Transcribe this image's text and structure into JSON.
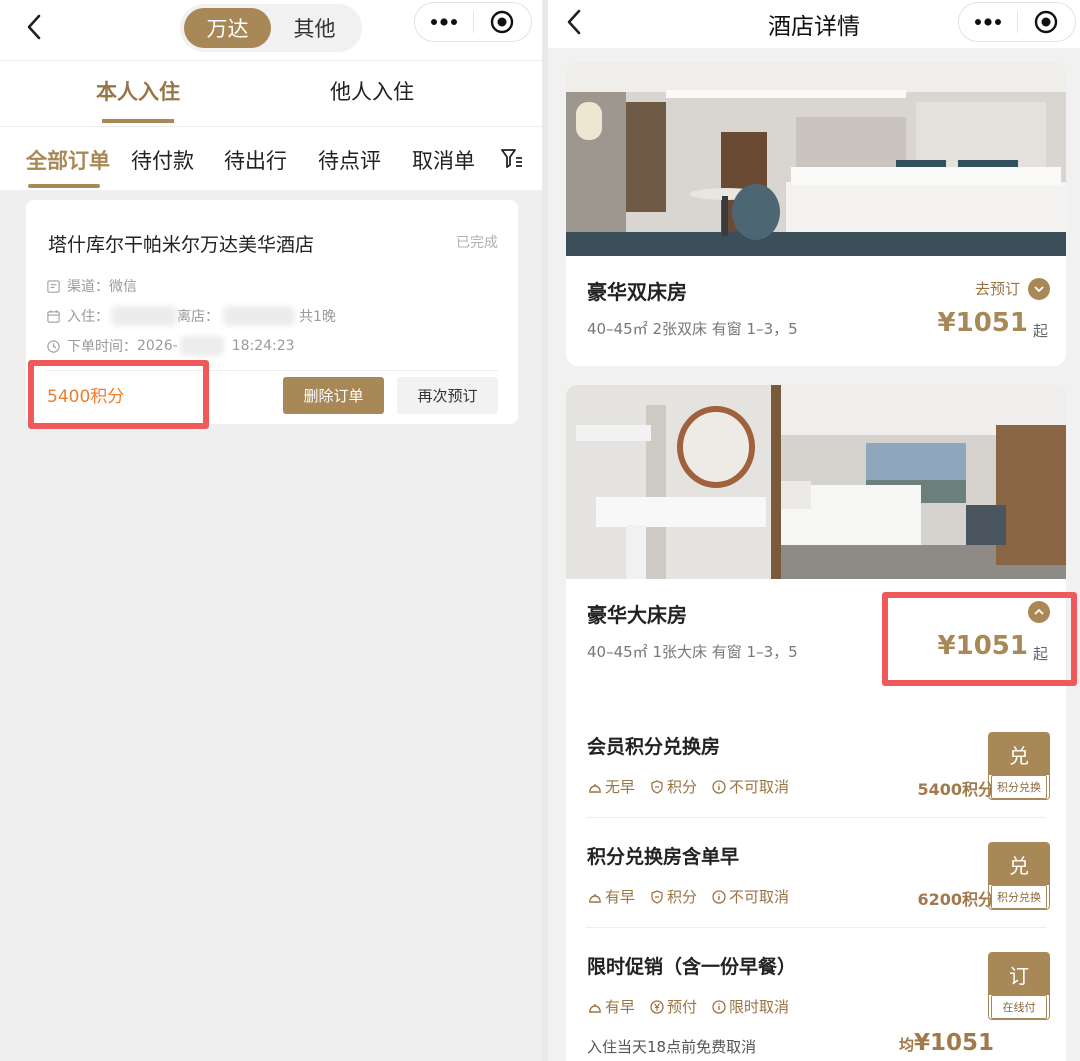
{
  "left": {
    "segment": [
      "万达",
      "其他"
    ],
    "stay_tabs": [
      "本人入住",
      "他人入住"
    ],
    "status_tabs": [
      "全部订单",
      "待付款",
      "待出行",
      "待点评",
      "取消单"
    ],
    "order": {
      "hotel": "塔什库尔干帕米尔万达美华酒店",
      "status": "已完成",
      "channel": "渠道：微信",
      "checkin_label": "入住：",
      "checkout_label": "离店：",
      "nights": "共1晚",
      "order_time_label": "下单时间：",
      "order_time_date": "2026-",
      "order_time_clock": "18:24:23",
      "points": "5400积分",
      "delete_btn": "删除订单",
      "rebook_btn": "再次预订"
    }
  },
  "right": {
    "title": "酒店详情",
    "rooms": [
      {
        "name": "豪华双床房",
        "spec": "40–45㎡ 2张双床 有窗 1–3，5",
        "price": "¥1051",
        "qi": "起",
        "book": "去预订"
      },
      {
        "name": "豪华大床房",
        "spec": "40–45㎡ 1张大床 有窗 1–3，5",
        "price": "¥1051",
        "qi": "起"
      }
    ],
    "rates": [
      {
        "title": "会员积分兑换房",
        "tags": [
          "无早",
          "积分",
          "不可取消"
        ],
        "price": "5400积分",
        "btn": "兑",
        "btn_sub": "积分兑换"
      },
      {
        "title": "积分兑换房含单早",
        "tags": [
          "有早",
          "积分",
          "不可取消"
        ],
        "price": "6200积分",
        "btn": "兑",
        "btn_sub": "积分兑换"
      },
      {
        "title": "限时促销（含一份早餐）",
        "tags": [
          "有早",
          "预付",
          "限时取消"
        ],
        "note": "入住当天18点前免费取消",
        "avg_prefix": "均",
        "avg_price": "¥1051",
        "btn": "订",
        "btn_sub": "在线付"
      }
    ]
  },
  "colors": {
    "accent": "#a98857",
    "highlight": "#ee5a5a",
    "points": "#f07c2f"
  }
}
